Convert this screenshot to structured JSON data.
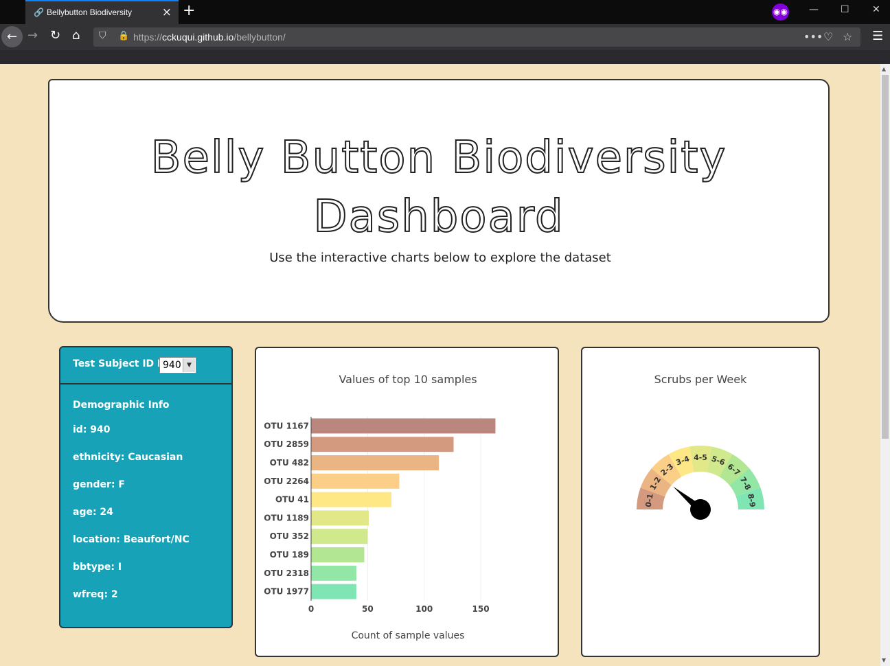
{
  "browser": {
    "tab_title": "Bellybutton Biodiversity",
    "url_prefix": "https://",
    "url_host": "cckuqui.github.io",
    "url_path": "/bellybutton/"
  },
  "header": {
    "title": "Belly Button Biodiversity Dashboard",
    "subtitle": "Use the interactive charts below to explore the dataset"
  },
  "panel": {
    "select_label": "Test Subject ID No.:",
    "selected_id": "940",
    "demo_title": "Demographic Info",
    "demographics": [
      "id: 940",
      "ethnicity: Caucasian",
      "gender: F",
      "age: 24",
      "location: Beaufort/NC",
      "bbtype: I",
      "wfreq: 2"
    ]
  },
  "colors": {
    "bars": [
      "#7fe5b3",
      "#92e6a6",
      "#b3e692",
      "#cfe98c",
      "#e2e887",
      "#fde885",
      "#fbcf88",
      "#ebb483",
      "#d49a80",
      "#b9877e"
    ],
    "gauge_sectors": [
      "#d49a80",
      "#ebb483",
      "#fbcf88",
      "#fde885",
      "#e2e887",
      "#cfe98c",
      "#b3e692",
      "#92e6a6",
      "#7fe5b3"
    ]
  },
  "chart_data": [
    {
      "type": "bar",
      "orientation": "horizontal",
      "title": "Values of top 10 samples",
      "xlabel": "Count of sample values",
      "ylabel": "",
      "categories": [
        "OTU 1977",
        "OTU 2318",
        "OTU 189",
        "OTU 352",
        "OTU 1189",
        "OTU 41",
        "OTU 2264",
        "OTU 482",
        "OTU 2859",
        "OTU 1167"
      ],
      "values": [
        40,
        40,
        47,
        50,
        51,
        71,
        78,
        113,
        126,
        163
      ],
      "xlim": [
        0,
        170
      ],
      "xticks": [
        0,
        50,
        100,
        150
      ],
      "grid": true
    },
    {
      "type": "gauge",
      "title": "Scrubs per Week",
      "sectors": [
        "0-1",
        "1-2",
        "2-3",
        "3-4",
        "4-5",
        "5-6",
        "6-7",
        "7-8",
        "8-9"
      ],
      "range": [
        0,
        9
      ],
      "value": 2
    }
  ]
}
